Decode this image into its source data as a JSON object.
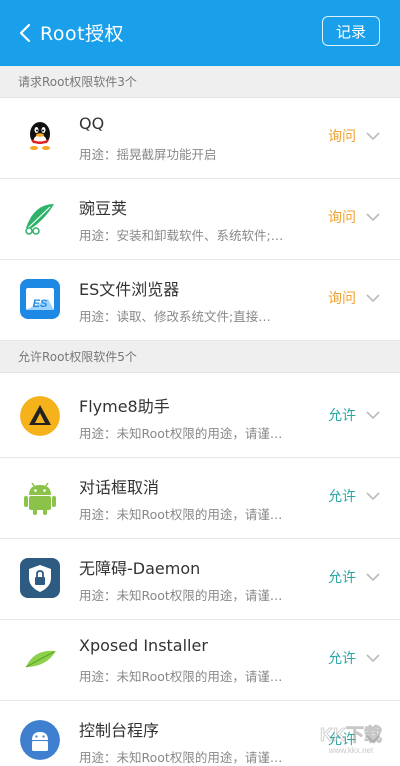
{
  "header": {
    "title": "Root授权",
    "record_label": "记录"
  },
  "sections": [
    {
      "title": "请求Root权限软件3个",
      "apps": [
        {
          "name": "QQ",
          "desc": "用途：摇晃截屏功能开启",
          "status": "询问",
          "status_type": "ask",
          "icon": "qq-penguin-icon"
        },
        {
          "name": "豌豆荚",
          "desc": "用途：安装和卸载软件、系统软件;…",
          "status": "询问",
          "status_type": "ask",
          "icon": "wandoujia-icon"
        },
        {
          "name": "ES文件浏览器",
          "desc": "用途：读取、修改系统文件;直接…",
          "status": "询问",
          "status_type": "ask",
          "icon": "es-file-explorer-icon"
        }
      ]
    },
    {
      "title": "允许Root权限软件5个",
      "apps": [
        {
          "name": "Flyme8助手",
          "desc": "用途：未知Root权限的用途，请谨…",
          "status": "允许",
          "status_type": "allow",
          "icon": "flyme-helper-icon"
        },
        {
          "name": "对话框取消",
          "desc": "用途：未知Root权限的用途，请谨…",
          "status": "允许",
          "status_type": "allow",
          "icon": "android-robot-icon"
        },
        {
          "name": "无障碍-Daemon",
          "desc": "用途：未知Root权限的用途，请谨…",
          "status": "允许",
          "status_type": "allow",
          "icon": "lock-shield-icon"
        },
        {
          "name": "Xposed Installer",
          "desc": "用途：未知Root权限的用途，请谨…",
          "status": "允许",
          "status_type": "allow",
          "icon": "xposed-leaf-icon"
        },
        {
          "name": "控制台程序",
          "desc": "用途：未知Root权限的用途，请谨…",
          "status": "允许",
          "status_type": "allow",
          "icon": "android-console-icon"
        }
      ]
    }
  ],
  "colors": {
    "header": "#1aa0ea",
    "ask": "#f0a22e",
    "allow": "#2ba8a4"
  },
  "watermark": {
    "text": "KK下载",
    "url": "www.kkx.net"
  }
}
